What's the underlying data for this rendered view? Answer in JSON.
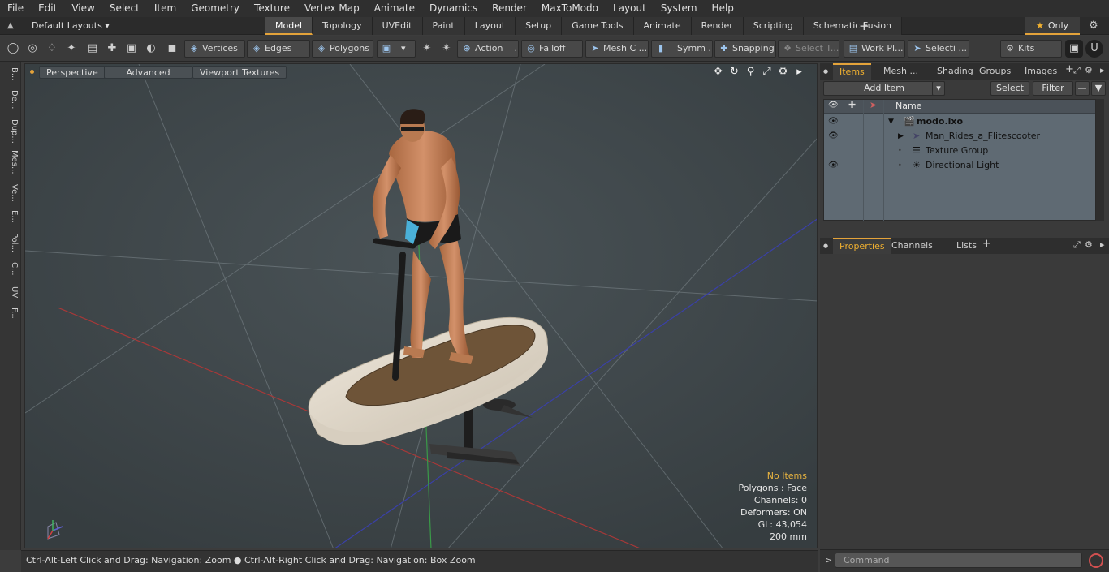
{
  "menu": [
    "File",
    "Edit",
    "View",
    "Select",
    "Item",
    "Geometry",
    "Texture",
    "Vertex Map",
    "Animate",
    "Dynamics",
    "Render",
    "MaxToModo",
    "Layout",
    "System",
    "Help"
  ],
  "layouts": {
    "label": "Default Layouts ▾"
  },
  "layout_tabs": [
    {
      "label": "Model",
      "active": true
    },
    {
      "label": "Topology"
    },
    {
      "label": "UVEdit"
    },
    {
      "label": "Paint"
    },
    {
      "label": "Layout"
    },
    {
      "label": "Setup"
    },
    {
      "label": "Game Tools"
    },
    {
      "label": "Animate"
    },
    {
      "label": "Render"
    },
    {
      "label": "Scripting"
    },
    {
      "label": "Schematic Fusion"
    }
  ],
  "only_label": "Only",
  "toolbar": {
    "vertices": "Vertices",
    "edges": "Edges",
    "polygons": "Polygons",
    "action": "Action",
    "action_more": "...",
    "falloff": "Falloff",
    "mesh": "Mesh C ...",
    "symm": "Symm ...",
    "snapping": "Snapping",
    "select_t": "Select T...",
    "workpl": "Work Pl...",
    "selecti": "Selecti ...",
    "kits": "Kits"
  },
  "left_tabs": [
    "B...",
    "De...",
    "Dup...",
    "Mes...",
    "Ve...",
    "E...",
    "Pol...",
    "C...",
    "UV",
    "F..."
  ],
  "viewport": {
    "perspective": "Perspective",
    "advanced": "Advanced",
    "viewport_textures": "Viewport Textures",
    "info": {
      "no_items": "No Items",
      "polygons": "Polygons : Face",
      "channels": "Channels: 0",
      "deformers": "Deformers: ON",
      "gl": "GL: 43,054",
      "size": "200 mm"
    }
  },
  "status": "Ctrl-Alt-Left Click and Drag: Navigation: Zoom ● Ctrl-Alt-Right Click and Drag: Navigation: Box Zoom",
  "items_panel": {
    "tabs": [
      "Items",
      "Mesh ...",
      "Shading",
      "Groups",
      "Images"
    ],
    "add_item": "Add Item",
    "select": "Select",
    "filter": "Filter",
    "name_header": "Name",
    "tree": [
      {
        "label": "modo.lxo",
        "level": 0,
        "icon": "scene-icon"
      },
      {
        "label": "Man_Rides_a_Flitescooter",
        "level": 1,
        "icon": "locator-icon"
      },
      {
        "label": "Texture Group",
        "level": 1,
        "icon": "texture-group-icon"
      },
      {
        "label": "Directional Light",
        "level": 1,
        "icon": "light-icon"
      }
    ]
  },
  "properties_panel": {
    "tabs": [
      "Properties",
      "Channels",
      "Lists"
    ]
  },
  "command": {
    "placeholder": "Command"
  }
}
